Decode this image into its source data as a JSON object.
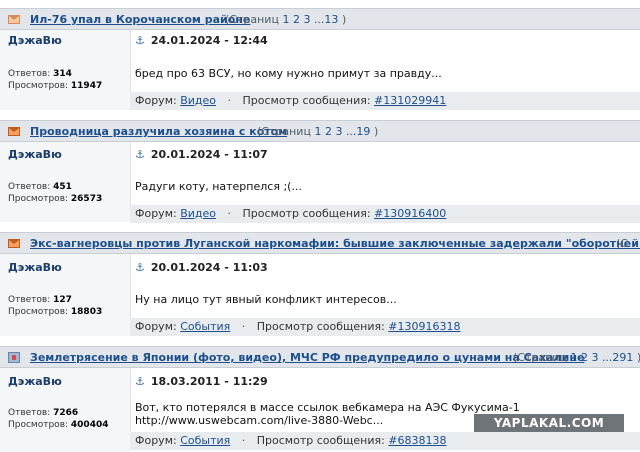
{
  "topics": [
    {
      "icon": "envelope-light-icon",
      "title": "Ил-76 упал в Корочанском районе",
      "pages_prefix": "(Страниц",
      "pages": [
        "1",
        "2",
        "3",
        "...13"
      ],
      "pages_suffix": ")",
      "author": "ДэжаВю",
      "date": "24.01.2024 - 12:44",
      "replies_label": "Ответов:",
      "replies": "314",
      "views_label": "Просмотров:",
      "views": "11947",
      "text": "бред про 63 ВСУ, но кому нужно примут за правду...",
      "forum_label": "Форум:",
      "forum": "Видео",
      "view_label": "Просмотр сообщения:",
      "post_id": "#131029941"
    },
    {
      "icon": "envelope-icon",
      "title": "Проводница разлучила хозяина с котом",
      "pages_prefix": "(Страниц",
      "pages": [
        "1",
        "2",
        "3",
        "...19"
      ],
      "pages_suffix": ")",
      "author": "ДэжаВю",
      "date": "20.01.2024 - 11:07",
      "replies_label": "Ответов:",
      "replies": "451",
      "views_label": "Просмотров:",
      "views": "26573",
      "text": "Радуги коту, натерпелся ;(...",
      "forum_label": "Форум:",
      "forum": "Видео",
      "view_label": "Просмотр сообщения:",
      "post_id": "#130916400"
    },
    {
      "icon": "envelope-icon",
      "title": "Экс-вагнеровцы против Луганской наркомафии: бывшие заключенные задержали \"оборотней в погонах\"",
      "pages_prefix": "(С",
      "pages": [],
      "pages_suffix": "",
      "author": "ДэжаВю",
      "date": "20.01.2024 - 11:03",
      "replies_label": "Ответов:",
      "replies": "127",
      "views_label": "Просмотров:",
      "views": "18803",
      "text": "Ну на лицо тут явный конфликт интересов...",
      "forum_label": "Форум:",
      "forum": "События",
      "view_label": "Просмотр сообщения:",
      "post_id": "#130916318"
    },
    {
      "icon": "pinned-topic-icon",
      "title": "Землетрясение в Японии (фото, видео), МЧС РФ предупредило о цунами на Сахалине",
      "pages_prefix": "(Страниц",
      "pages": [
        "1",
        "2",
        "3",
        "...291"
      ],
      "pages_suffix": ")",
      "author": "ДэжаВю",
      "date": "18.03.2011 - 11:29",
      "replies_label": "Ответов:",
      "replies": "7266",
      "views_label": "Просмотров:",
      "views": "400404",
      "text": "Вот, кто потерялся в массе ссылок вебкамера на АЭС Фукусима-1",
      "text2": "http://www.uswebcam.com/live-3880-Webc...",
      "forum_label": "Форум:",
      "forum": "События",
      "view_label": "Просмотр сообщения:",
      "post_id": "#6838138"
    }
  ],
  "watermark": "YAPLAKAL.COM"
}
